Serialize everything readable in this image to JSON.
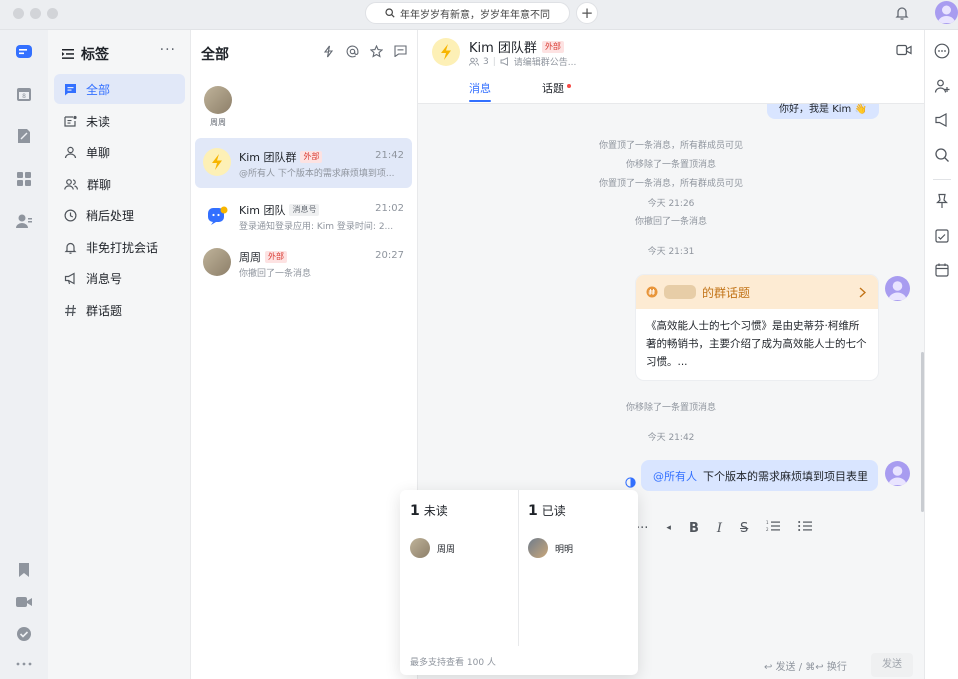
{
  "search": {
    "text": "年年岁岁有新意，岁岁年年意不同"
  },
  "tags": {
    "title": "标签",
    "items": [
      {
        "label": "全部",
        "icon": "chat-icon"
      },
      {
        "label": "未读",
        "icon": "unread-icon"
      },
      {
        "label": "单聊",
        "icon": "user-icon"
      },
      {
        "label": "群聊",
        "icon": "group-icon"
      },
      {
        "label": "稍后处理",
        "icon": "clock-icon"
      },
      {
        "label": "非免打扰会话",
        "icon": "bell-icon"
      },
      {
        "label": "消息号",
        "icon": "megaphone-icon"
      },
      {
        "label": "群话题",
        "icon": "hashtag-icon"
      }
    ]
  },
  "chatlist": {
    "title": "全部",
    "pinned_name": "周周",
    "conversations": [
      {
        "name": "Kim 团队群",
        "tag": "外部",
        "time": "21:42",
        "preview": "@所有人 下个版本的需求麻烦填到项..."
      },
      {
        "name": "Kim 团队",
        "tag": "消息号",
        "time": "21:02",
        "preview": "登录通知登录应用: Kim 登录时间: 2..."
      },
      {
        "name": "周周",
        "tag": "外部",
        "time": "20:27",
        "preview": "你撤回了一条消息"
      }
    ]
  },
  "chat": {
    "title": "Kim 团队群",
    "tag": "外部",
    "member_count": "3",
    "announcement": "请编辑群公告...",
    "tabs": [
      "消息",
      "话题"
    ],
    "top_bubble": "你好，我是 Kim 👋",
    "system_messages": [
      "你置顶了一条消息，所有群成员可见",
      "你移除了一条置顶消息",
      "你置顶了一条消息，所有群成员可见",
      "今天 21:26",
      "你撤回了一条消息",
      "今天 21:31"
    ],
    "topic": {
      "title": "的群话题",
      "body": "《高效能人士的七个习惯》是由史蒂芬·柯维所著的畅销书，主要介绍了成为高效能人士的七个习惯。..."
    },
    "after_topic": [
      "你移除了一条置顶消息",
      "今天 21:42"
    ],
    "mention": "@所有人",
    "mention_text": "下个版本的需求麻烦填到项目表里",
    "send_hint": "↩ 发送 / ⌘↩ 换行",
    "send_label": "发送"
  },
  "read_popup": {
    "unread_count": "1",
    "unread_label": "未读",
    "unread_user": "周周",
    "read_count": "1",
    "read_label": "已读",
    "read_user": "明明",
    "footer": "最多支持查看 100 人"
  },
  "colors": {
    "accent": "#3370ff",
    "external_tag": "#d83931",
    "topic_header": "#fdebd3"
  }
}
